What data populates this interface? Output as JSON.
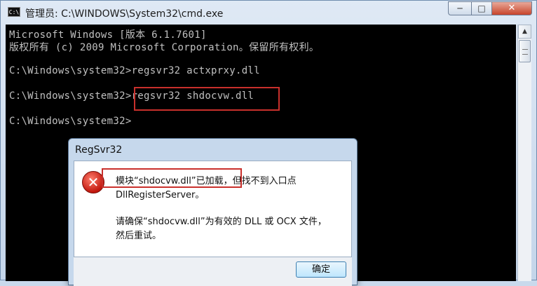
{
  "window": {
    "title": "管理员: C:\\WINDOWS\\System32\\cmd.exe",
    "icon_label": "C:\\",
    "minimize_glyph": "─",
    "maximize_glyph": "□",
    "close_glyph": "✕"
  },
  "console": {
    "lines": [
      "Microsoft Windows [版本 6.1.7601]",
      "版权所有 (c) 2009 Microsoft Corporation。保留所有权利。",
      "C:\\Windows\\system32>regsvr32 actxprxy.dll",
      "C:\\Windows\\system32>regsvr32 shdocvw.dll",
      "C:\\Windows\\system32>"
    ]
  },
  "scrollbar": {
    "up_glyph": "▲"
  },
  "dialog": {
    "title": "RegSvr32",
    "icon_glyph": "✕",
    "message_lines": [
      "模块“shdocvw.dll”已加载，但找不到入口点",
      "DllRegisterServer。",
      "请确保“shdocvw.dll”为有效的 DLL 或 OCX 文件，",
      "然后重试。"
    ],
    "ok_label": "确定"
  },
  "colors": {
    "highlight_border": "#c9302c",
    "console_text": "#c0c0c0",
    "console_bg": "#000000"
  }
}
